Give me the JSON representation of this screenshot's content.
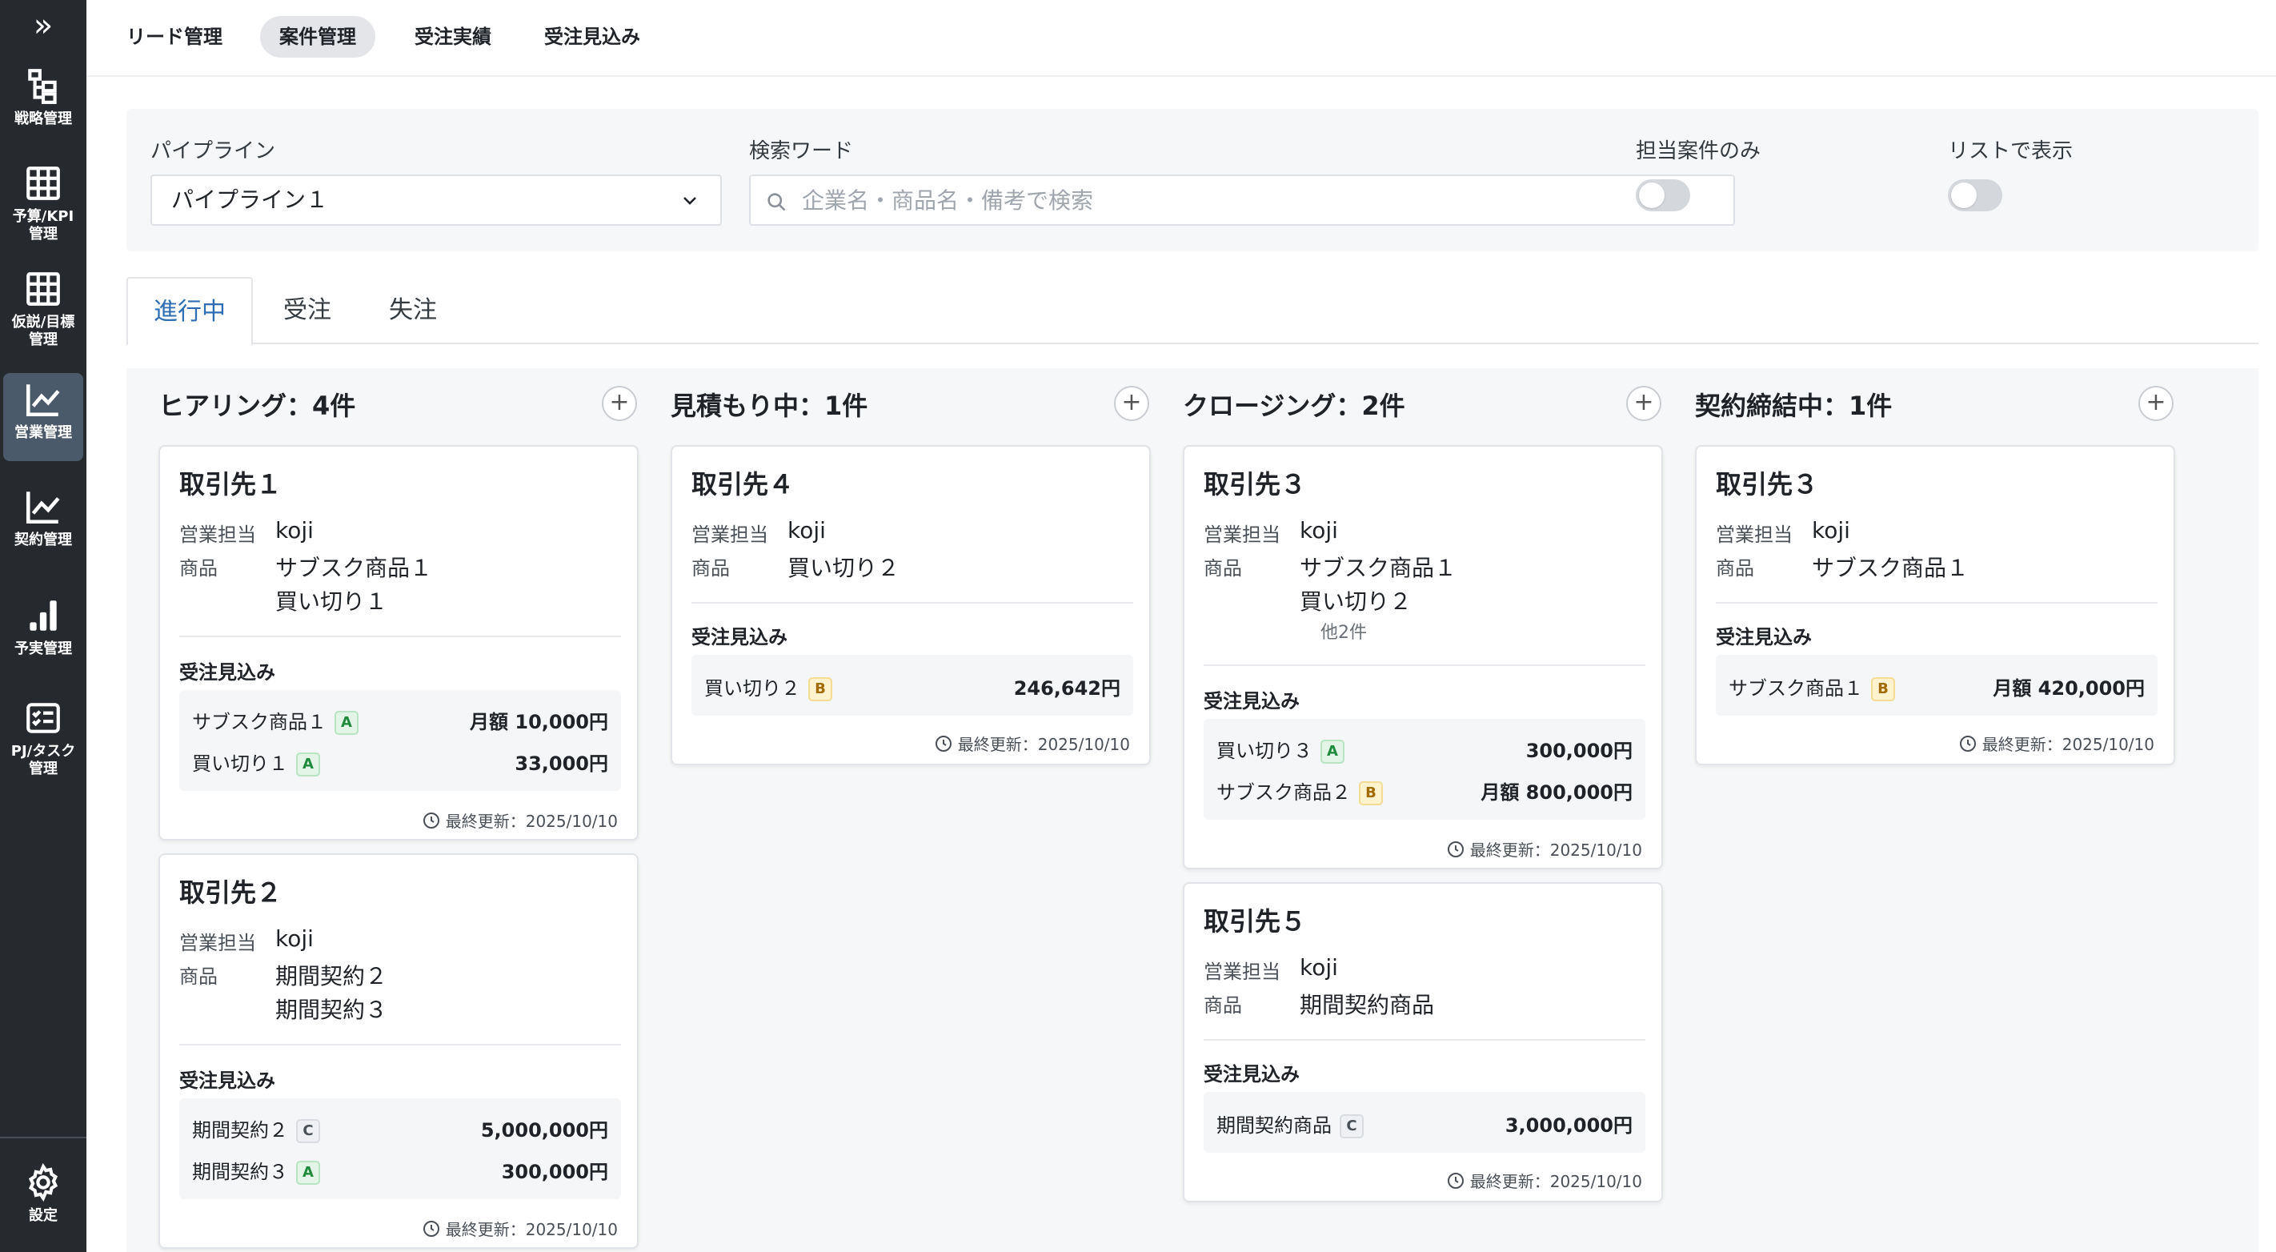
{
  "sidebar": {
    "toggle_icon": "double-chevron-right-icon",
    "items": [
      {
        "label": "戦略管理",
        "icon": "hierarchy-icon"
      },
      {
        "label": "予算/KPI\n管理",
        "icon": "table-grid-icon"
      },
      {
        "label": "仮説/目標\n管理",
        "icon": "table-grid-icon"
      },
      {
        "label": "営業管理",
        "icon": "line-chart-icon",
        "active": true
      },
      {
        "label": "契約管理",
        "icon": "line-chart-icon"
      },
      {
        "label": "予実管理",
        "icon": "bar-chart-icon"
      },
      {
        "label": "PJ/タスク\n管理",
        "icon": "checklist-icon"
      }
    ],
    "settings_label": "設定"
  },
  "topnav": {
    "items": [
      "リード管理",
      "案件管理",
      "受注実績",
      "受注見込み"
    ],
    "active": "案件管理"
  },
  "filter": {
    "pipeline_label": "パイプライン",
    "pipeline_value": "パイプライン１",
    "search_label": "検索ワード",
    "search_placeholder": "企業名・商品名・備考で検索",
    "mine_only_label": "担当案件のみ",
    "list_view_label": "リストで表示"
  },
  "status_tabs": {
    "items": [
      "進行中",
      "受注",
      "失注"
    ],
    "active": "進行中"
  },
  "labels": {
    "sales_rep": "営業担当",
    "product": "商品",
    "forecast": "受注見込み"
  },
  "columns": [
    {
      "title": "ヒアリング：4件",
      "add": "+",
      "cards": [
        {
          "title": "取引先１",
          "rep": "koji",
          "products": [
            "サブスク商品１",
            "買い切り１"
          ],
          "more": "",
          "forecast": [
            {
              "name": "サブスク商品１",
              "rank": "A",
              "amount": "月額 10,000円"
            },
            {
              "name": "買い切り１",
              "rank": "A",
              "amount": "33,000円"
            }
          ],
          "updated": "最終更新：2025/10/10"
        },
        {
          "title": "取引先２",
          "rep": "koji",
          "products": [
            "期間契約２",
            "期間契約３"
          ],
          "more": "",
          "forecast": [
            {
              "name": "期間契約２",
              "rank": "C",
              "amount": "5,000,000円"
            },
            {
              "name": "期間契約３",
              "rank": "A",
              "amount": "300,000円"
            }
          ],
          "updated": "最終更新：2025/10/10"
        }
      ]
    },
    {
      "title": "見積もり中：1件",
      "add": "+",
      "cards": [
        {
          "title": "取引先４",
          "rep": "koji",
          "products": [
            "買い切り２"
          ],
          "more": "",
          "forecast": [
            {
              "name": "買い切り２",
              "rank": "B",
              "amount": "246,642円"
            }
          ],
          "updated": "最終更新：2025/10/10"
        }
      ]
    },
    {
      "title": "クロージング：2件",
      "add": "+",
      "cards": [
        {
          "title": "取引先３",
          "rep": "koji",
          "products": [
            "サブスク商品１",
            "買い切り２"
          ],
          "more": "他2件",
          "forecast": [
            {
              "name": "買い切り３",
              "rank": "A",
              "amount": "300,000円"
            },
            {
              "name": "サブスク商品２",
              "rank": "B",
              "amount": "月額 800,000円"
            }
          ],
          "updated": "最終更新：2025/10/10"
        },
        {
          "title": "取引先５",
          "rep": "koji",
          "products": [
            "期間契約商品"
          ],
          "more": "",
          "forecast": [
            {
              "name": "期間契約商品",
              "rank": "C",
              "amount": "3,000,000円"
            }
          ],
          "updated": "最終更新：2025/10/10"
        }
      ]
    },
    {
      "title": "契約締結中：1件",
      "add": "+",
      "cards": [
        {
          "title": "取引先３",
          "rep": "koji",
          "products": [
            "サブスク商品１"
          ],
          "more": "",
          "forecast": [
            {
              "name": "サブスク商品１",
              "rank": "B",
              "amount": "月額 420,000円"
            }
          ],
          "updated": "最終更新：2025/10/10"
        }
      ]
    }
  ],
  "colors": {
    "sidebar_bg": "#262a2e",
    "sidebar_active": "#4b5a6a",
    "tab_active_text": "#2f6db5",
    "board_bg": "#f6f7f8"
  }
}
